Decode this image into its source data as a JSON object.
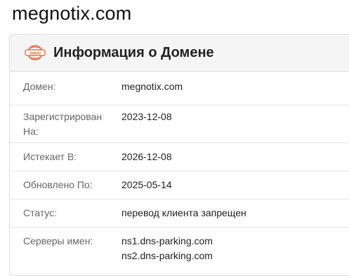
{
  "page": {
    "title": "megnotix.com"
  },
  "card": {
    "title": "Информация о Домене",
    "icon": "www-globe-icon",
    "accent": "#e8734a"
  },
  "rows": [
    {
      "label": "Домен:",
      "value": "megnotix.com"
    },
    {
      "label": "Зарегистрирован На:",
      "value": "2023-12-08"
    },
    {
      "label": "Истекает В:",
      "value": "2026-12-08"
    },
    {
      "label": "Обновлено По:",
      "value": "2025-05-14"
    },
    {
      "label": "Статус:",
      "value": "перевод клиента запрещен"
    },
    {
      "label": "Серверы имен:",
      "values": [
        "ns1.dns-parking.com",
        "ns2.dns-parking.com"
      ]
    }
  ]
}
